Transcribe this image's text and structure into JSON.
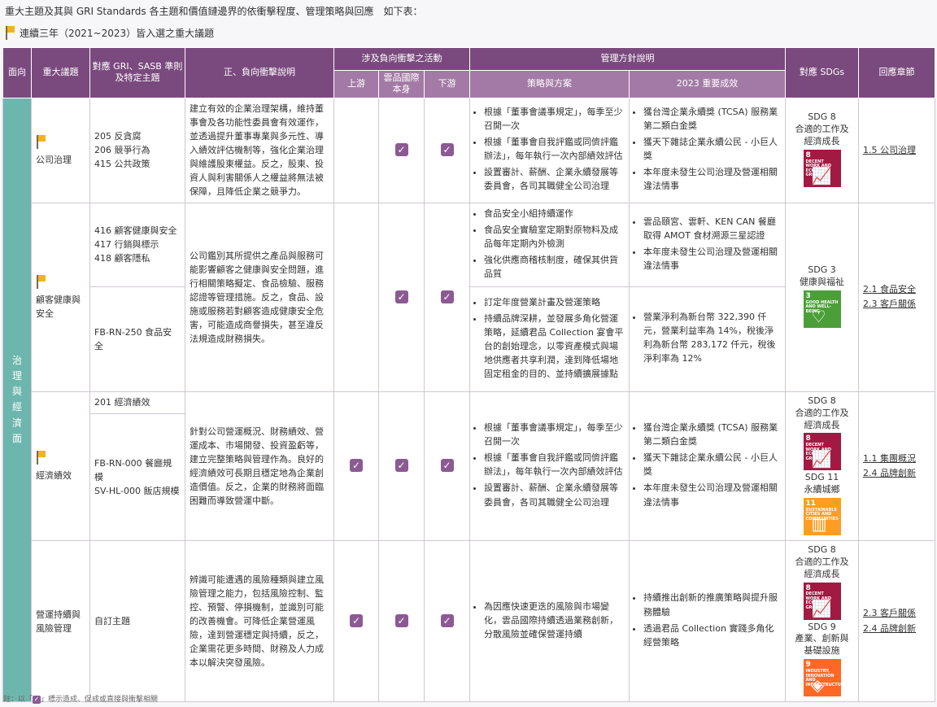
{
  "intro": "重大主題及其與 GRI Standards 各主題和價值鏈邊界的依衝擊程度、管理策略與回應　如下表：",
  "legend": "連續三年（2021~2023）皆入選之重大議題",
  "headers": {
    "aspect": "面向",
    "topic": "重大議題",
    "gri": "對應 GRI、SASB 準則及特定主題",
    "impact": "正、負向衝擊說明",
    "activities": "涉及負向衝擊之活動",
    "upstream": "上游",
    "self": "雲品國際本身",
    "downstream": "下游",
    "mgmt": "管理方針說明",
    "strategy": "策略與方案",
    "results": "2023 重要成效",
    "sdgs": "對應 SDGs",
    "chapter": "回應章節"
  },
  "side_label": [
    "治",
    "理",
    "與",
    "經",
    "濟",
    "面"
  ],
  "check_mark": "✓",
  "rows": {
    "gov": {
      "topic": "公司治理",
      "gri": [
        "205 反貪腐",
        "206 競爭行為",
        "415 公共政策"
      ],
      "impact": "建立有效的企業治理架構，維持董事會及各功能性委員會有效運作，並透過提升董事專業與多元性、導入績效評估機制等，強化企業治理與維護股東權益。反之，股東、投資人與利害關係人之權益將無法被保障，且降低企業之競爭力。",
      "strategy": [
        "根據「董事會議事規定」，每季至少召開一次",
        "根據「董事會自我評鑑或同儕評鑑辦法」，每年執行一次內部績效評估",
        "設置審計、薪酬、企業永續發展等委員會，各司其職健全公司治理"
      ],
      "results": [
        "獲台灣企業永續獎 (TCSA) 服務業第二類白金獎",
        "獲天下雜誌企業永續公民 - 小巨人獎",
        "本年度未發生公司治理及營運相關違法情事"
      ],
      "sdg": [
        "SDG 8",
        "合適的工作及",
        "經濟成長"
      ],
      "chapter": [
        "1.5 公司治理"
      ]
    },
    "cust": {
      "topic": "顧客健康與安全",
      "gri": [
        "416 顧客健康與安全",
        "417 行銷與標示",
        "418 顧客隱私"
      ],
      "sasb": "FB-RN-250 食品安全",
      "impact": "公司鑑別其所提供之產品與服務可能影響顧客之健康與安全問題，進行相關策略擬定、食品檢驗、服務認證等管理措施。反之，食品、設施或服務若對顧客造成健康安全危害，可能造成商譽損失，甚至違反法規造成財務損失。",
      "strategy1": [
        "食品安全小組持續運作",
        "食品安全實驗室定期對原物料及成品每年定期內外檢測",
        "強化供應商稽核制度，確保其供貨品質"
      ],
      "results1": [
        "雲品頤宮、雲軒、KEN CAN 餐廳取得 AMOT 食材溯源三星認證",
        "本年度未發生公司治理及營運相關違法情事"
      ],
      "strategy2": [
        "訂定年度營業計畫及營運策略",
        "持續品牌深耕，並發展多角化營運策略，延續君品 Collection 宴會平台的創始理念，以零資產模式與場地供應者共享利潤，達到降低場地固定租金的目的、並持續擴展據點"
      ],
      "results2": [
        "營業淨利為新台幣 322,390 仟元，營業利益率為 14%，稅後淨利為新台幣 283,172 仟元，稅後淨利率為 12%"
      ],
      "sdg": [
        "SDG 3",
        "健康與福祉"
      ],
      "chapter": [
        "2.1 食品安全",
        "2.3 客戶關係"
      ]
    },
    "econ": {
      "topic": "經濟績效",
      "gri": [
        "201 經濟績效"
      ],
      "sasb": [
        "FB-RN-000 餐廳規模",
        "SV-HL-000 飯店規模"
      ],
      "impact": "針對公司營運概況、財務績效、營運成本、市場開發、投資盈虧等，建立完整策略與管理作為。良好的經濟績效可長期且穩定地為企業創造價值。反之，企業的財務將面臨困難而導致營運中斷。",
      "strategy": [
        "根據「董事會議事規定」，每季至少召開一次",
        "根據「董事會自我評鑑或同儕評鑑辦法」，每年執行一次內部績效評估",
        "設置審計、薪酬、企業永續發展等委員會，各司其職健全公司治理"
      ],
      "results": [
        "獲台灣企業永續獎 (TCSA) 服務業第二類白金獎",
        "獲天下雜誌企業永續公民 - 小巨人獎",
        "本年度未發生公司治理及營運相關違法情事"
      ],
      "sdg1": [
        "SDG 8",
        "合適的工作及",
        "經濟成長"
      ],
      "sdg2": [
        "SDG 11",
        "永續城鄉"
      ],
      "chapter": [
        "1.1 集團概況",
        "2.4 品牌創新"
      ]
    },
    "biz": {
      "topic": "營運持續與風險管理",
      "gri": [
        "自訂主題"
      ],
      "impact": "辨識可能遭遇的風險種類與建立風險管理之能力，包括風險控制、監控、預警、停損機制，並識別可能的改善機會。可降低企業營運風險，達到營運穩定與持續，反之，企業需花更多時間、財務及人力成本以解決突發風險。",
      "strategy": [
        "為因應快速更迭的風險與市場變化，雲品國際持續透過業務創新，分散風險並確保營運持續"
      ],
      "results": [
        "持續推出創新的推廣策略與提升服務體驗",
        "透過君品 Collection 實踐多角化經營策略"
      ],
      "sdg1": [
        "SDG 8",
        "合適的工作及",
        "經濟成長"
      ],
      "sdg2": [
        "SDG 9",
        "產業、創新與",
        "基礎設施"
      ],
      "chapter": [
        "2.3 客戶關係",
        "2.4 品牌創新"
      ]
    }
  },
  "sdg_icons": {
    "s8": {
      "num": "8",
      "text": "DECENT WORK AND ECONOMIC GROWTH",
      "glyph": "📈",
      "color": "#a21942"
    },
    "s3": {
      "num": "3",
      "text": "GOOD HEALTH AND WELL-BEING",
      "glyph": "♡",
      "color": "#4c9f38"
    },
    "s11": {
      "num": "11",
      "text": "SUSTAINABLE CITIES AND COMMUNITIES",
      "glyph": "▥",
      "color": "#fd9d24"
    },
    "s9": {
      "num": "9",
      "text": "INDUSTRY, INNOVATION AND INFRASTRUCTURE",
      "glyph": "◈",
      "color": "#fd6925"
    }
  },
  "footnote": [
    "註：以「",
    "」標示造成、促成或直接與衝擊相關"
  ]
}
